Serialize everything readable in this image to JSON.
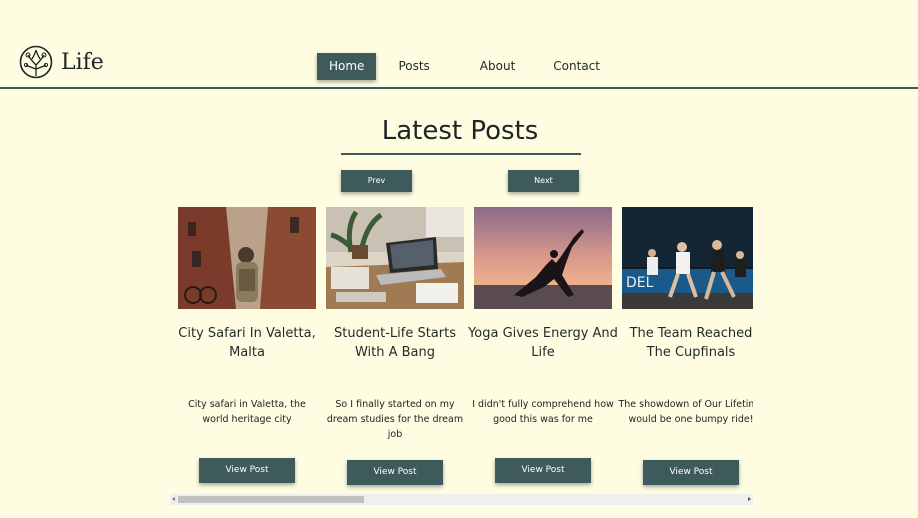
{
  "brand": {
    "name": "Life",
    "icon": "tree-globe-icon"
  },
  "nav": {
    "home": "Home",
    "posts": "Posts",
    "about": "About",
    "contact": "Contact",
    "active": "Home"
  },
  "section": {
    "title": "Latest Posts",
    "prev_label": "Prev",
    "next_label": "Next"
  },
  "posts": [
    {
      "title": "City Safari In Valetta, Malta",
      "excerpt": "City safari in Valetta, the world heritage city",
      "button": "View Post",
      "image": "narrow-city-street-photo"
    },
    {
      "title": "Student-Life Starts With A Bang",
      "excerpt": "So I finally started on my dream studies for the dream job",
      "button": "View Post",
      "image": "desk-laptop-photo"
    },
    {
      "title": "Yoga Gives Energy And Life",
      "excerpt": "I didn't fully comprehend how good this was for me",
      "button": "View Post",
      "image": "yoga-sunset-photo"
    },
    {
      "title": "The Team Reached The Cupfinals",
      "excerpt": "The showdown of Our Lifetime would be one bumpy ride!",
      "button": "View Post",
      "image": "handball-match-photo"
    }
  ],
  "colors": {
    "background": "#fefde2",
    "accent": "#3e5a5c",
    "text": "#1f2a2a"
  }
}
